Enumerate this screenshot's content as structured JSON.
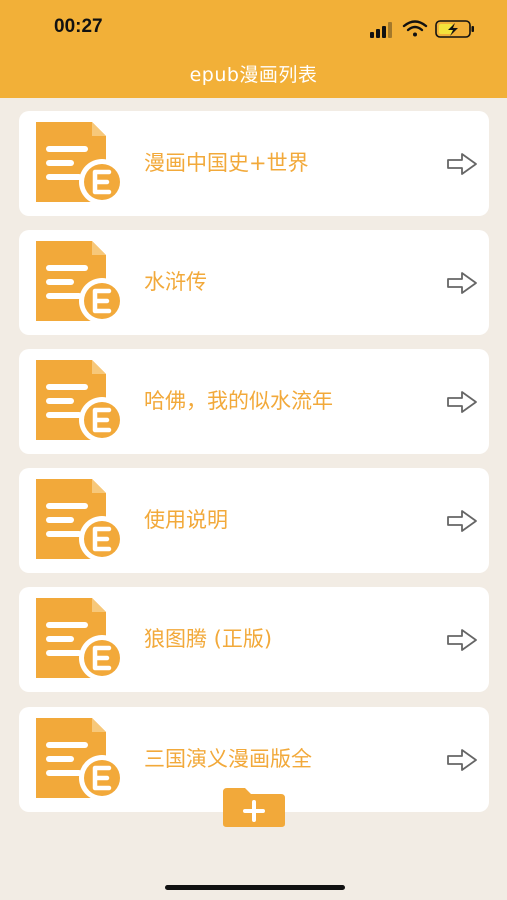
{
  "status_bar": {
    "time": "00:27",
    "icons": [
      "signal-icon",
      "wifi-icon",
      "battery-charging-icon"
    ]
  },
  "header": {
    "title": "epub漫画列表"
  },
  "colors": {
    "accent": "#F2B038",
    "background": "#F2ECE4",
    "card": "#FFFFFF",
    "text": "#F2A93A",
    "arrow": "#666666"
  },
  "list": {
    "items": [
      {
        "label": "漫画中国史+世界",
        "icon": "epub-file-icon",
        "action_icon": "arrow-right-icon"
      },
      {
        "label": "水浒传",
        "icon": "epub-file-icon",
        "action_icon": "arrow-right-icon"
      },
      {
        "label": "哈佛，我的似水流年",
        "icon": "epub-file-icon",
        "action_icon": "arrow-right-icon"
      },
      {
        "label": "使用说明",
        "icon": "epub-file-icon",
        "action_icon": "arrow-right-icon"
      },
      {
        "label": "狼图腾 (正版)",
        "icon": "epub-file-icon",
        "action_icon": "arrow-right-icon"
      },
      {
        "label": "三国演义漫画版全",
        "icon": "epub-file-icon",
        "action_icon": "arrow-right-icon"
      }
    ]
  },
  "add_button": {
    "icon": "add-folder-icon"
  }
}
